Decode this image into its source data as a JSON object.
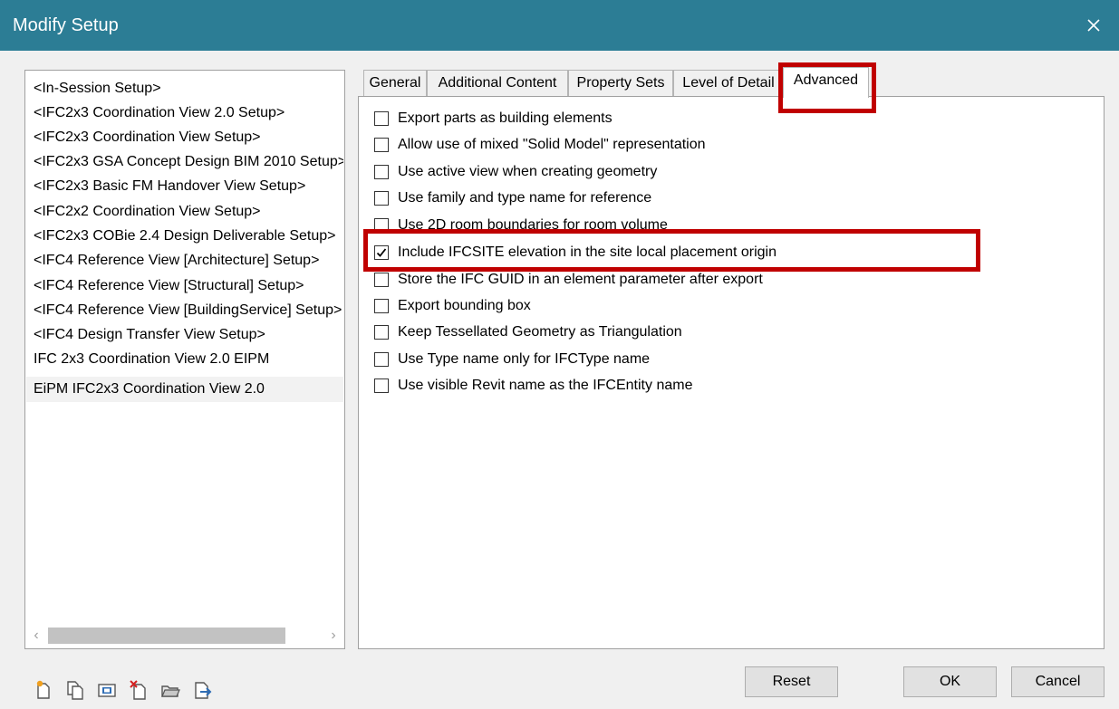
{
  "window": {
    "title": "Modify Setup",
    "close_icon": "close-icon"
  },
  "setup_list": {
    "items": [
      "<In-Session Setup>",
      "<IFC2x3 Coordination View 2.0 Setup>",
      "<IFC2x3 Coordination View Setup>",
      "<IFC2x3 GSA Concept Design BIM 2010 Setup>",
      "<IFC2x3 Basic FM Handover View Setup>",
      "<IFC2x2 Coordination View Setup>",
      "<IFC2x3 COBie 2.4 Design Deliverable Setup>",
      "<IFC4 Reference View [Architecture] Setup>",
      "<IFC4 Reference View [Structural] Setup>",
      "<IFC4 Reference View [BuildingService] Setup>",
      "<IFC4 Design Transfer View Setup>",
      "IFC 2x3 Coordination View 2.0 EIPM",
      "EiPM IFC2x3 Coordination View 2.0"
    ],
    "selected_index": 12,
    "scroll_left_glyph": "‹",
    "scroll_right_glyph": "›"
  },
  "tabs": [
    {
      "label": "General"
    },
    {
      "label": "Additional Content"
    },
    {
      "label": "Property Sets"
    },
    {
      "label": "Level of Detail"
    },
    {
      "label": "Advanced"
    }
  ],
  "active_tab": "Advanced",
  "options": [
    {
      "label": "Export parts as building elements",
      "checked": false
    },
    {
      "label": "Allow use of mixed \"Solid Model\" representation",
      "checked": false
    },
    {
      "label": "Use active view when creating geometry",
      "checked": false
    },
    {
      "label": "Use family and type name for reference",
      "checked": false
    },
    {
      "label": "Use 2D room boundaries for room volume",
      "checked": false
    },
    {
      "label": "Include IFCSITE elevation in the site local placement origin",
      "checked": true
    },
    {
      "label": "Store the IFC GUID in an element parameter after export",
      "checked": false
    },
    {
      "label": "Export bounding box",
      "checked": false
    },
    {
      "label": "Keep Tessellated Geometry as Triangulation",
      "checked": false
    },
    {
      "label": "Use Type name only for IFCType name",
      "checked": false
    },
    {
      "label": "Use visible Revit name as the IFCEntity name",
      "checked": false
    }
  ],
  "toolbar": {
    "icons": [
      "new-setup-icon",
      "duplicate-setup-icon",
      "rename-setup-icon",
      "delete-setup-icon",
      "import-setup-icon",
      "export-setup-icon"
    ]
  },
  "buttons": {
    "reset": "Reset",
    "ok": "OK",
    "cancel": "Cancel"
  },
  "colors": {
    "titlebar": "#2c7d95",
    "highlight": "#c00000",
    "selected_item": "#f2f2f2"
  }
}
